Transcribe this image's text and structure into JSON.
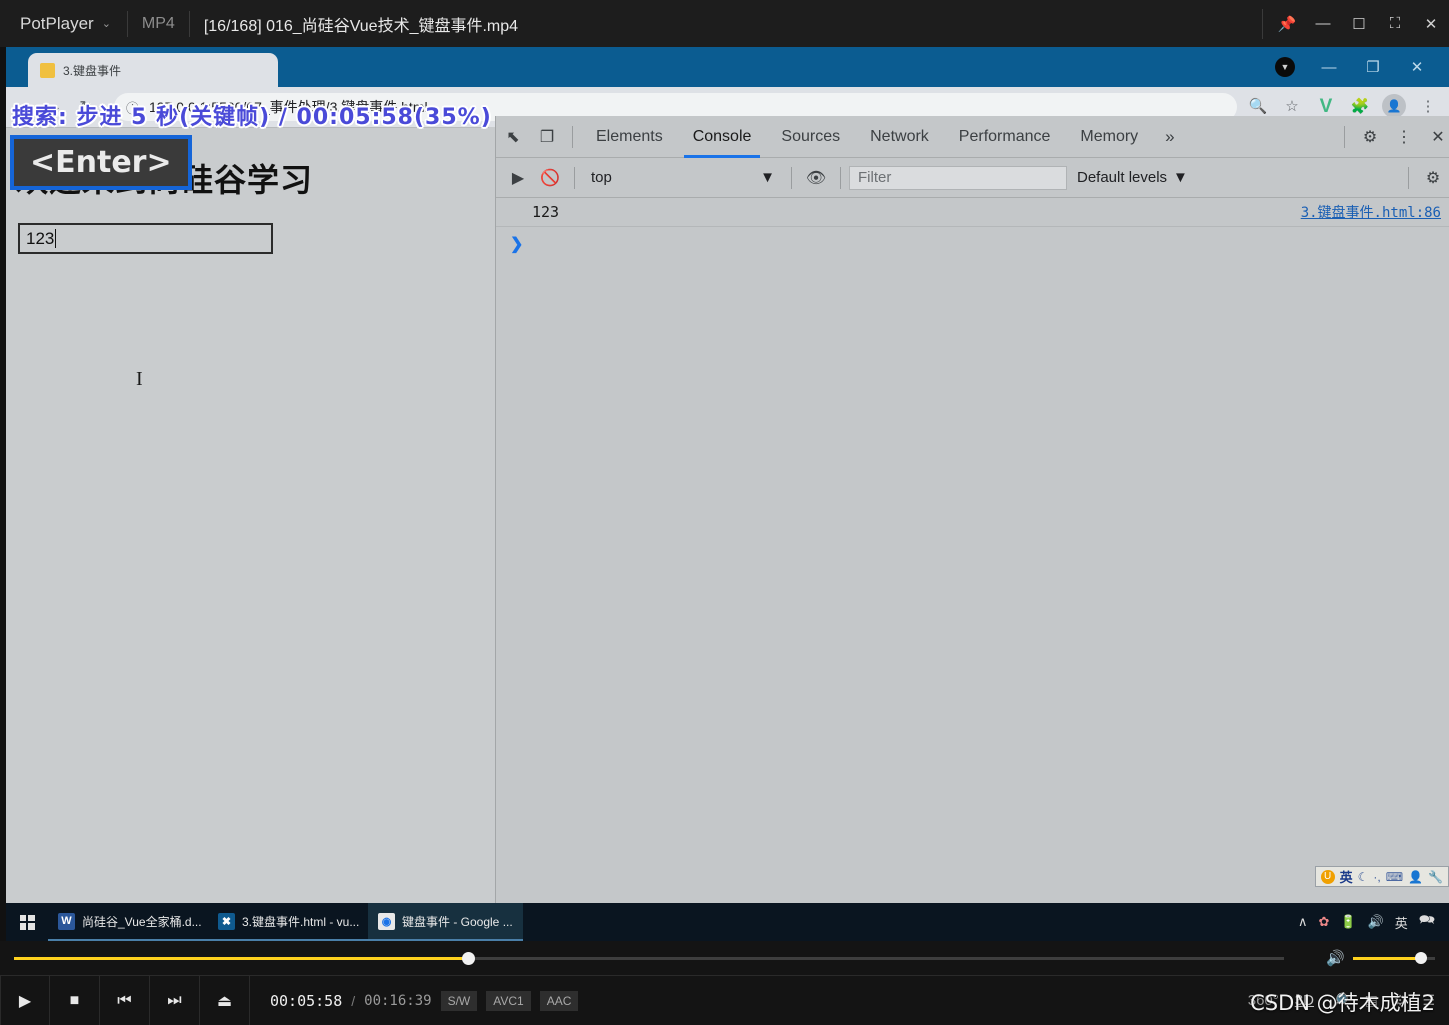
{
  "potplayer": {
    "app_name": "PotPlayer",
    "caret": "⌄",
    "file_type": "MP4",
    "title": "[16/168] 016_尚硅谷Vue技术_键盘事件.mp4",
    "window_buttons": [
      {
        "name": "pin-button",
        "glyph": "📌"
      },
      {
        "name": "minimize-button",
        "glyph": "—"
      },
      {
        "name": "maximize-button",
        "glyph": "☐"
      },
      {
        "name": "fullscreen-button",
        "glyph": "⛶"
      },
      {
        "name": "close-button",
        "glyph": "✕"
      }
    ]
  },
  "osd": {
    "seek_text": "搜索: 步进 5 秒(关键帧)  /  00:05:58(35%)",
    "key_text": "<Enter>"
  },
  "chrome": {
    "tab": {
      "title": "3.键盘事件",
      "favicon": "page-icon"
    },
    "window_controls": [
      {
        "name": "chrome-profile-indicator",
        "glyph": "▼"
      },
      {
        "name": "chrome-minimize-button",
        "glyph": "—"
      },
      {
        "name": "chrome-restore-button",
        "glyph": "❐"
      },
      {
        "name": "chrome-close-button",
        "glyph": "✕"
      }
    ],
    "nav": {
      "back": "←",
      "forward": "→",
      "reload": "↻"
    },
    "omnibox": {
      "info_icon": "ⓘ",
      "url": "127.0.0.1:5500/07_事件处理/3.键盘事件.html"
    },
    "toolbar_icons": [
      {
        "name": "zoom-icon",
        "glyph": "🔍"
      },
      {
        "name": "bookmark-star-icon",
        "glyph": "☆"
      },
      {
        "name": "vue-devtools-icon",
        "glyph": "V"
      },
      {
        "name": "extensions-puzzle-icon",
        "glyph": "🧩"
      },
      {
        "name": "profile-avatar-icon",
        "glyph": "👤"
      },
      {
        "name": "chrome-menu-icon",
        "glyph": "⋮"
      }
    ]
  },
  "page": {
    "heading": "欢迎来到尚硅谷学习",
    "input_value": "123"
  },
  "devtools": {
    "left_icons": [
      {
        "name": "inspect-element-icon",
        "glyph": "⬉"
      },
      {
        "name": "device-toolbar-icon",
        "glyph": "❐"
      }
    ],
    "tabs": [
      {
        "label": "Elements",
        "active": false
      },
      {
        "label": "Console",
        "active": true
      },
      {
        "label": "Sources",
        "active": false
      },
      {
        "label": "Network",
        "active": false
      },
      {
        "label": "Performance",
        "active": false
      },
      {
        "label": "Memory",
        "active": false
      }
    ],
    "more_tabs": "»",
    "right_icons": [
      {
        "name": "devtools-settings-gear-icon",
        "glyph": "⚙"
      },
      {
        "name": "devtools-menu-icon",
        "glyph": "⋮"
      },
      {
        "name": "devtools-close-icon",
        "glyph": "✕"
      }
    ],
    "console_bar": {
      "sidebar_toggle": "▶",
      "clear_console": "🚫",
      "context": "top",
      "context_caret": "▼",
      "live_expression": "👁",
      "filter_placeholder": "Filter",
      "levels": "Default levels",
      "levels_caret": "▼",
      "settings_gear": "⚙"
    },
    "logs": [
      {
        "message": "123",
        "source": "3.键盘事件.html:86"
      }
    ],
    "prompt_caret": "❯"
  },
  "ime_bar": {
    "logo": "U",
    "mode": "英",
    "icons": [
      "☾",
      "·,",
      "⌨",
      "👤",
      "🔧"
    ]
  },
  "taskbar": {
    "start_label": "start-button",
    "tasks": [
      {
        "label": "尚硅谷_Vue全家桶.d...",
        "icon": "W",
        "icon_color": "#2b579a",
        "active": false
      },
      {
        "label": "3.键盘事件.html - vu...",
        "icon": "✖",
        "icon_color": "#0f5a8f",
        "active": false
      },
      {
        "label": "键盘事件 - Google ...",
        "icon": "◉",
        "icon_color": "#e8e8e8",
        "active": true
      }
    ],
    "tray": [
      {
        "name": "tray-chevron-up-icon",
        "glyph": "∧"
      },
      {
        "name": "tray-security-icon",
        "glyph": "✿"
      },
      {
        "name": "tray-battery-icon",
        "glyph": "🔋"
      },
      {
        "name": "tray-volume-icon",
        "glyph": "🔊"
      },
      {
        "name": "tray-ime-icon",
        "glyph": "英"
      },
      {
        "name": "tray-notifications-icon",
        "glyph": "🗪"
      }
    ]
  },
  "player_controls": {
    "buttons": [
      {
        "name": "play-button",
        "glyph": "▶"
      },
      {
        "name": "stop-button",
        "glyph": "■"
      },
      {
        "name": "previous-button",
        "glyph": "⏮"
      },
      {
        "name": "next-button",
        "glyph": "⏭"
      },
      {
        "name": "eject-button",
        "glyph": "⏏"
      }
    ],
    "current_time": "00:05:58",
    "time_separator": "/",
    "total_time": "00:16:39",
    "badges": [
      "S/W",
      "AVC1",
      "AAC"
    ],
    "right_buttons": [
      {
        "name": "view-360-button",
        "label": "360°"
      },
      {
        "name": "view-3d-button",
        "label": "3D"
      },
      {
        "name": "search-subtitle-button",
        "glyph": "🔎"
      },
      {
        "name": "playlist-button",
        "glyph": "▤"
      },
      {
        "name": "preferences-button",
        "glyph": "⚙"
      },
      {
        "name": "menu-button",
        "glyph": "☰"
      }
    ],
    "volume_icon": "🔊",
    "progress_percent": 35,
    "volume_percent": 83,
    "watermark": "CSDN @待木成植2"
  },
  "colors": {
    "accent_blue": "#1a73e8",
    "potplayer_yellow": "#ffd21e",
    "chrome_tabstrip": "#0b5c91",
    "devtools_bg": "#c4c7c9",
    "vue_green": "#41b883"
  }
}
